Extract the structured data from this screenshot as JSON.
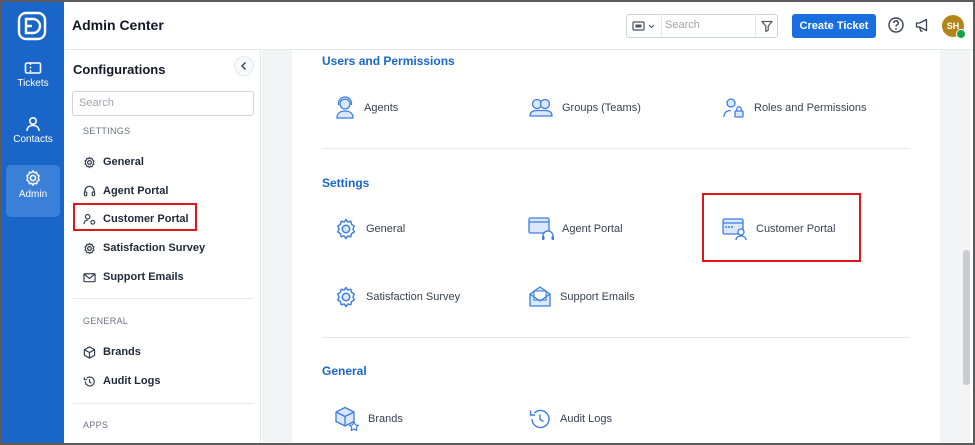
{
  "app": {
    "title": "Admin Center"
  },
  "rail": {
    "items": [
      {
        "label": "Tickets",
        "icon": "ticket-icon"
      },
      {
        "label": "Contacts",
        "icon": "contact-icon"
      },
      {
        "label": "Admin",
        "icon": "gear-icon",
        "active": true
      }
    ]
  },
  "topbar": {
    "search_placeholder": "Search",
    "create_label": "Create Ticket",
    "avatar_initials": "SH"
  },
  "config": {
    "title": "Configurations",
    "search_placeholder": "Search",
    "sections": [
      {
        "label": "SETTINGS",
        "items": [
          "General",
          "Agent Portal",
          "Customer Portal",
          "Satisfaction Survey",
          "Support Emails"
        ]
      },
      {
        "label": "GENERAL",
        "items": [
          "Brands",
          "Audit Logs"
        ]
      },
      {
        "label": "APPS",
        "items": []
      }
    ],
    "highlighted_item": "Customer Portal"
  },
  "main": {
    "groups": [
      {
        "title": "Users and Permissions",
        "tiles": [
          "Agents",
          "Groups (Teams)",
          "Roles and Permissions"
        ]
      },
      {
        "title": "Settings",
        "tiles": [
          "General",
          "Agent Portal",
          "Customer Portal",
          "Satisfaction Survey",
          "Support Emails"
        ]
      },
      {
        "title": "General",
        "tiles": [
          "Brands",
          "Audit Logs"
        ]
      }
    ],
    "highlighted_tile": "Customer Portal"
  },
  "colors": {
    "rail": "#1a66c8",
    "accent": "#1a6fe0",
    "highlight": "#e0161b",
    "group_title": "#1a66c8"
  }
}
